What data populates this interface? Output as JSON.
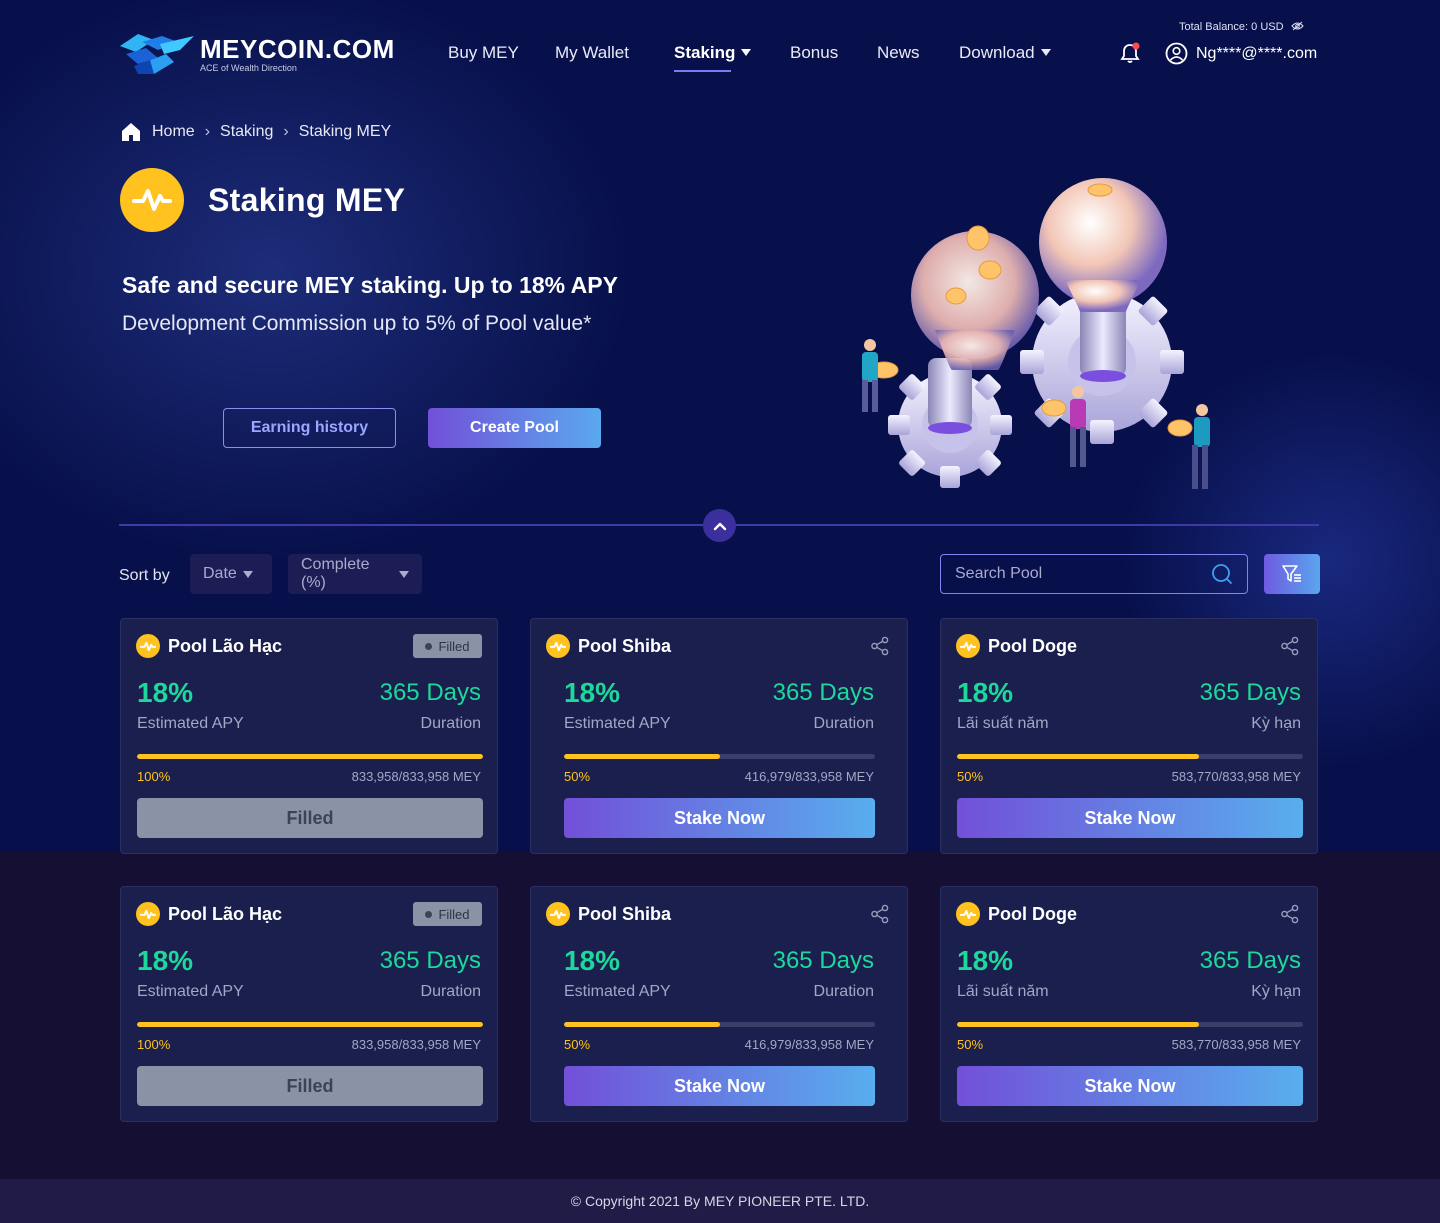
{
  "brand": {
    "name": "MEYCOIN.COM",
    "tagline": "ACE of Wealth Direction"
  },
  "nav": [
    {
      "label": "Buy MEY"
    },
    {
      "label": "My Wallet"
    },
    {
      "label": "Staking",
      "active": true,
      "dropdown": true
    },
    {
      "label": "Bonus"
    },
    {
      "label": "News"
    },
    {
      "label": "Download",
      "dropdown": true
    }
  ],
  "header": {
    "balance_label": "Total Balance:",
    "balance_value": "0 USD",
    "user_email": "Ng****@****.com"
  },
  "breadcrumb": [
    "Home",
    "Staking",
    "Staking MEY"
  ],
  "hero": {
    "title": "Staking MEY",
    "tagline": "Safe and secure MEY staking. Up to 18% APY",
    "subline": "Development Commission up to 5% of Pool value*",
    "earning_history_label": "Earning history",
    "create_pool_label": "Create Pool"
  },
  "controls": {
    "sort_label": "Sort by",
    "sort_date": "Date",
    "sort_complete": "Complete (%)",
    "search_placeholder": "Search Pool"
  },
  "pools": [
    {
      "name": "Pool Lão Hạc",
      "status": "Filled",
      "apy": "18%",
      "apy_label": "Estimated APY",
      "duration": "365 Days",
      "duration_label": "Duration",
      "progress": 1.0,
      "pct": "100%",
      "amount": "833,958/833,958 MEY",
      "action": "Filled"
    },
    {
      "name": "Pool Shiba",
      "status": "",
      "apy": "18%",
      "apy_label": "Estimated APY",
      "duration": "365 Days",
      "duration_label": "Duration",
      "progress": 0.5,
      "pct": "50%",
      "amount": "416,979/833,958 MEY",
      "action": "Stake Now"
    },
    {
      "name": "Pool Doge",
      "status": "",
      "apy": "18%",
      "apy_label": "Lãi suất năm",
      "duration": "365 Days",
      "duration_label": "Kỳ hạn",
      "progress": 0.7,
      "pct": "50%",
      "amount": "583,770/833,958 MEY",
      "action": "Stake Now"
    },
    {
      "name": "Pool Lão Hạc",
      "status": "Filled",
      "apy": "18%",
      "apy_label": "Estimated APY",
      "duration": "365 Days",
      "duration_label": "Duration",
      "progress": 1.0,
      "pct": "100%",
      "amount": "833,958/833,958 MEY",
      "action": "Filled"
    },
    {
      "name": "Pool Shiba",
      "status": "",
      "apy": "18%",
      "apy_label": "Estimated APY",
      "duration": "365 Days",
      "duration_label": "Duration",
      "progress": 0.5,
      "pct": "50%",
      "amount": "416,979/833,958 MEY",
      "action": "Stake Now"
    },
    {
      "name": "Pool Doge",
      "status": "",
      "apy": "18%",
      "apy_label": "Lãi suất năm",
      "duration": "365 Days",
      "duration_label": "Kỳ hạn",
      "progress": 0.7,
      "pct": "50%",
      "amount": "583,770/833,958 MEY",
      "action": "Stake Now"
    }
  ],
  "footer": {
    "copyright": "© Copyright 2021 By MEY PIONEER PTE. LTD."
  },
  "icons": [
    "home-icon",
    "chevron-right-icon",
    "bell-icon",
    "user-icon",
    "eye-off-icon",
    "search-icon",
    "filter-icon",
    "share-icon",
    "mey-coin-icon",
    "chevron-up-icon"
  ],
  "colors": {
    "accent_green": "#1dd89a",
    "progress_yellow": "#ffc21e",
    "primary_gradient_start": "#7250d8",
    "primary_gradient_end": "#58aeee",
    "hero_bg": "#07104a"
  }
}
